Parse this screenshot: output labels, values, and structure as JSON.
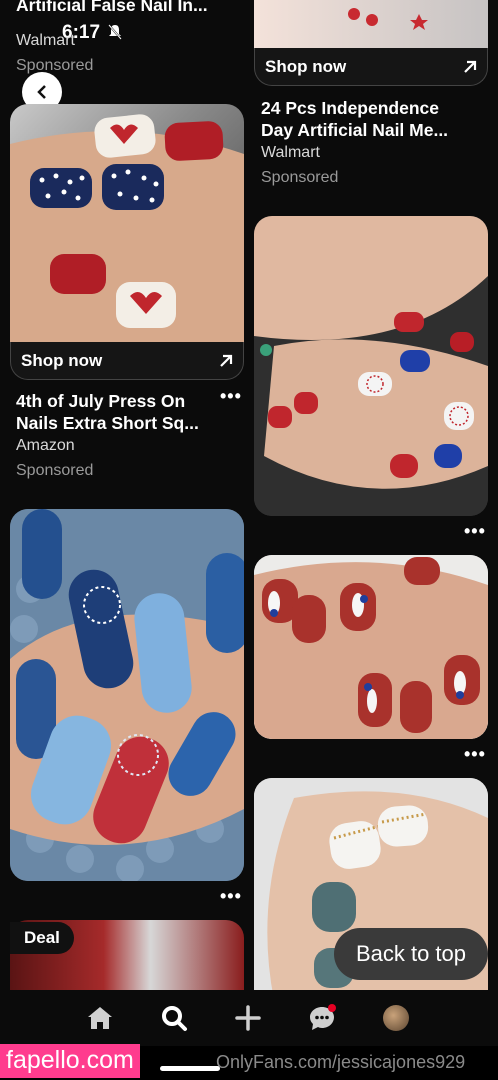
{
  "status": {
    "time": "6:17"
  },
  "left_column": {
    "top_pin": {
      "title": "Artificial False Nail In...",
      "source": "Walmart",
      "sponsored": "Sponsored"
    },
    "pin1": {
      "shop": "Shop now",
      "title_line1": "4th of July Press On",
      "title_line2": "Nails Extra Short Sq...",
      "source": "Amazon",
      "sponsored": "Sponsored",
      "more": "•••"
    },
    "pin2": {
      "more": "•••"
    },
    "pin3": {
      "badge": "Deal"
    }
  },
  "right_column": {
    "pin1": {
      "shop": "Shop now",
      "title_line1": "24 Pcs Independence",
      "title_line2": "Day Artificial Nail Me...",
      "source": "Walmart",
      "sponsored": "Sponsored"
    },
    "pin2": {
      "more": "•••"
    },
    "pin3": {
      "more": "•••"
    }
  },
  "back_to_top": "Back to top",
  "nav": {
    "items": [
      "home-icon",
      "search-icon",
      "add-icon",
      "messages-icon",
      "profile-avatar"
    ],
    "notification_color": "#e60023"
  },
  "watermark": {
    "left": "fapello.com",
    "right": "OnlyFans.com/jessicajones929"
  }
}
